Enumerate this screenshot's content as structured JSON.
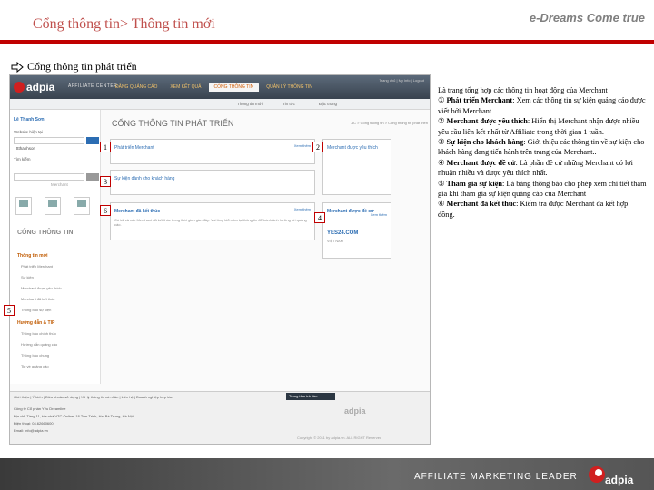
{
  "slide": {
    "title": "Cổng thông tin> Thông tin mới",
    "brand": "e-Dreams Come true",
    "section": "Cổng thông tin phát triển"
  },
  "screenshot": {
    "logo": "adpia",
    "affiliate_center": "AFFILIATE CENTER",
    "nav": [
      "ĐĂNG QUẢNG CÁO",
      "XEM KẾT QUẢ",
      "CỔNG THÔNG TIN",
      "QUẢN LÝ THÔNG TIN"
    ],
    "toplinks": "Trang chủ | My info | Logout",
    "subnav": [
      "Thông tin mới",
      "Tin tức",
      "Đặc trưng"
    ],
    "sidebar": {
      "user": "Lê Thanh Sơn",
      "website_label": "Website hiện tại",
      "website_value": "ttthanhson",
      "search_label": "Tìm kiếm",
      "search_placeholder": "Merchant",
      "icons": [
        "MAIL",
        "PRINT",
        "ECHOSHOT"
      ],
      "heading": "CỔNG THÔNG TIN",
      "sub1": "Thông tin mới",
      "links1": [
        "Phát triển Merchant",
        "Sự kiện",
        "Merchant được yêu thích",
        "Merchant đã kết thúc",
        "Thông báo sự kiện"
      ],
      "sub2": "Hướng dẫn & TIP",
      "links2": [
        "Thông báo chính thức",
        "Hướng dẫn quảng cáo",
        "Thông báo chung",
        "Tip về quảng cáo"
      ]
    },
    "main": {
      "title": "CỔNG THÔNG TIN PHÁT TRIỂN",
      "breadcrumb": "AC > Cổng thông tin > Cổng thông tin phát triển",
      "card1_title": "Phát triển Merchant",
      "card1_more": "Xem thêm",
      "card2_title": "Sự kiện dành cho khách hàng",
      "card3_title": "Merchant đã kết thúc",
      "card3_more": "Xem thêm",
      "card3_text": "Có tất cả các Merchant đã kết thúc trong thời gian gần đây. Vui lòng kiểm tra lại thông tin để tránh ảnh hưởng tới quảng cáo.",
      "right1_title": "Merchant được yêu thích",
      "right2_title": "Merchant được đề cử",
      "right2_more": "Xem thêm",
      "right2_brand": "YES24.COM",
      "right2_tag": "VIỆT NAM"
    },
    "footer": {
      "links": "Giới thiệu | Ý kiến | Điều khoản sử dụng | Xử lý thông tin cá nhân | Liên hệ | Doanh nghiệp hợp tác",
      "active": "Trung tâm trả tiền",
      "company": "Công ty Cổ phần Yêu Dreamline",
      "address": "Địa chỉ: Tầng 11, tòa nhà VTC Online, 18 Tam Trinh, Hai Bà Trưng, Hà Nội",
      "phone": "Điện thoại: 04.62660600",
      "email": "Email: info@adpia.vn",
      "copyright": "Copyright © 2011 by adpia.vn. ALL RIGHT Reserved"
    }
  },
  "markers": [
    "1",
    "2",
    "3",
    "4",
    "5",
    "6"
  ],
  "description": {
    "intro": "Là trang tổng hợp các thông tin hoạt động của Merchant",
    "items": [
      {
        "num": "①",
        "title": "Phát triển Merchant",
        "text": ": Xem các thông tin sự kiện quảng cáo được viết bởi Merchant"
      },
      {
        "num": "②",
        "title": "Merchant được yêu thích",
        "text": ": Hiển thị Merchant nhận được nhiều yêu cầu liên kết nhất từ Affiliate trong thời gian 1 tuần."
      },
      {
        "num": "③",
        "title": "Sự kiện cho khách hàng",
        "text": ": Giới thiệu các thông tin về sự kiện cho khách hàng đang tiến hành trên trang của Merchant.."
      },
      {
        "num": "④",
        "title": "Merchant được đề cử",
        "text": ": Là phần đề cử những Merchant có lợi nhuận nhiều và được yêu thích nhất."
      },
      {
        "num": "⑤",
        "title": "Tham gia sự kiện",
        "text": ": Là bảng thông báo cho phép xem chi tiết tham gia khi tham gia sự kiện quảng cáo của Merchant"
      },
      {
        "num": "⑥",
        "title": "Merchant đã kết thúc",
        "text": ": Kiểm tra được Merchant đã kết hợp đồng."
      }
    ]
  },
  "bottom": {
    "leader": "AFFILIATE MARKETING LEADER",
    "logo": "adpia"
  },
  "colors": {
    "accent": "#c00000",
    "title": "#c0504d",
    "link": "#2c6db3"
  }
}
